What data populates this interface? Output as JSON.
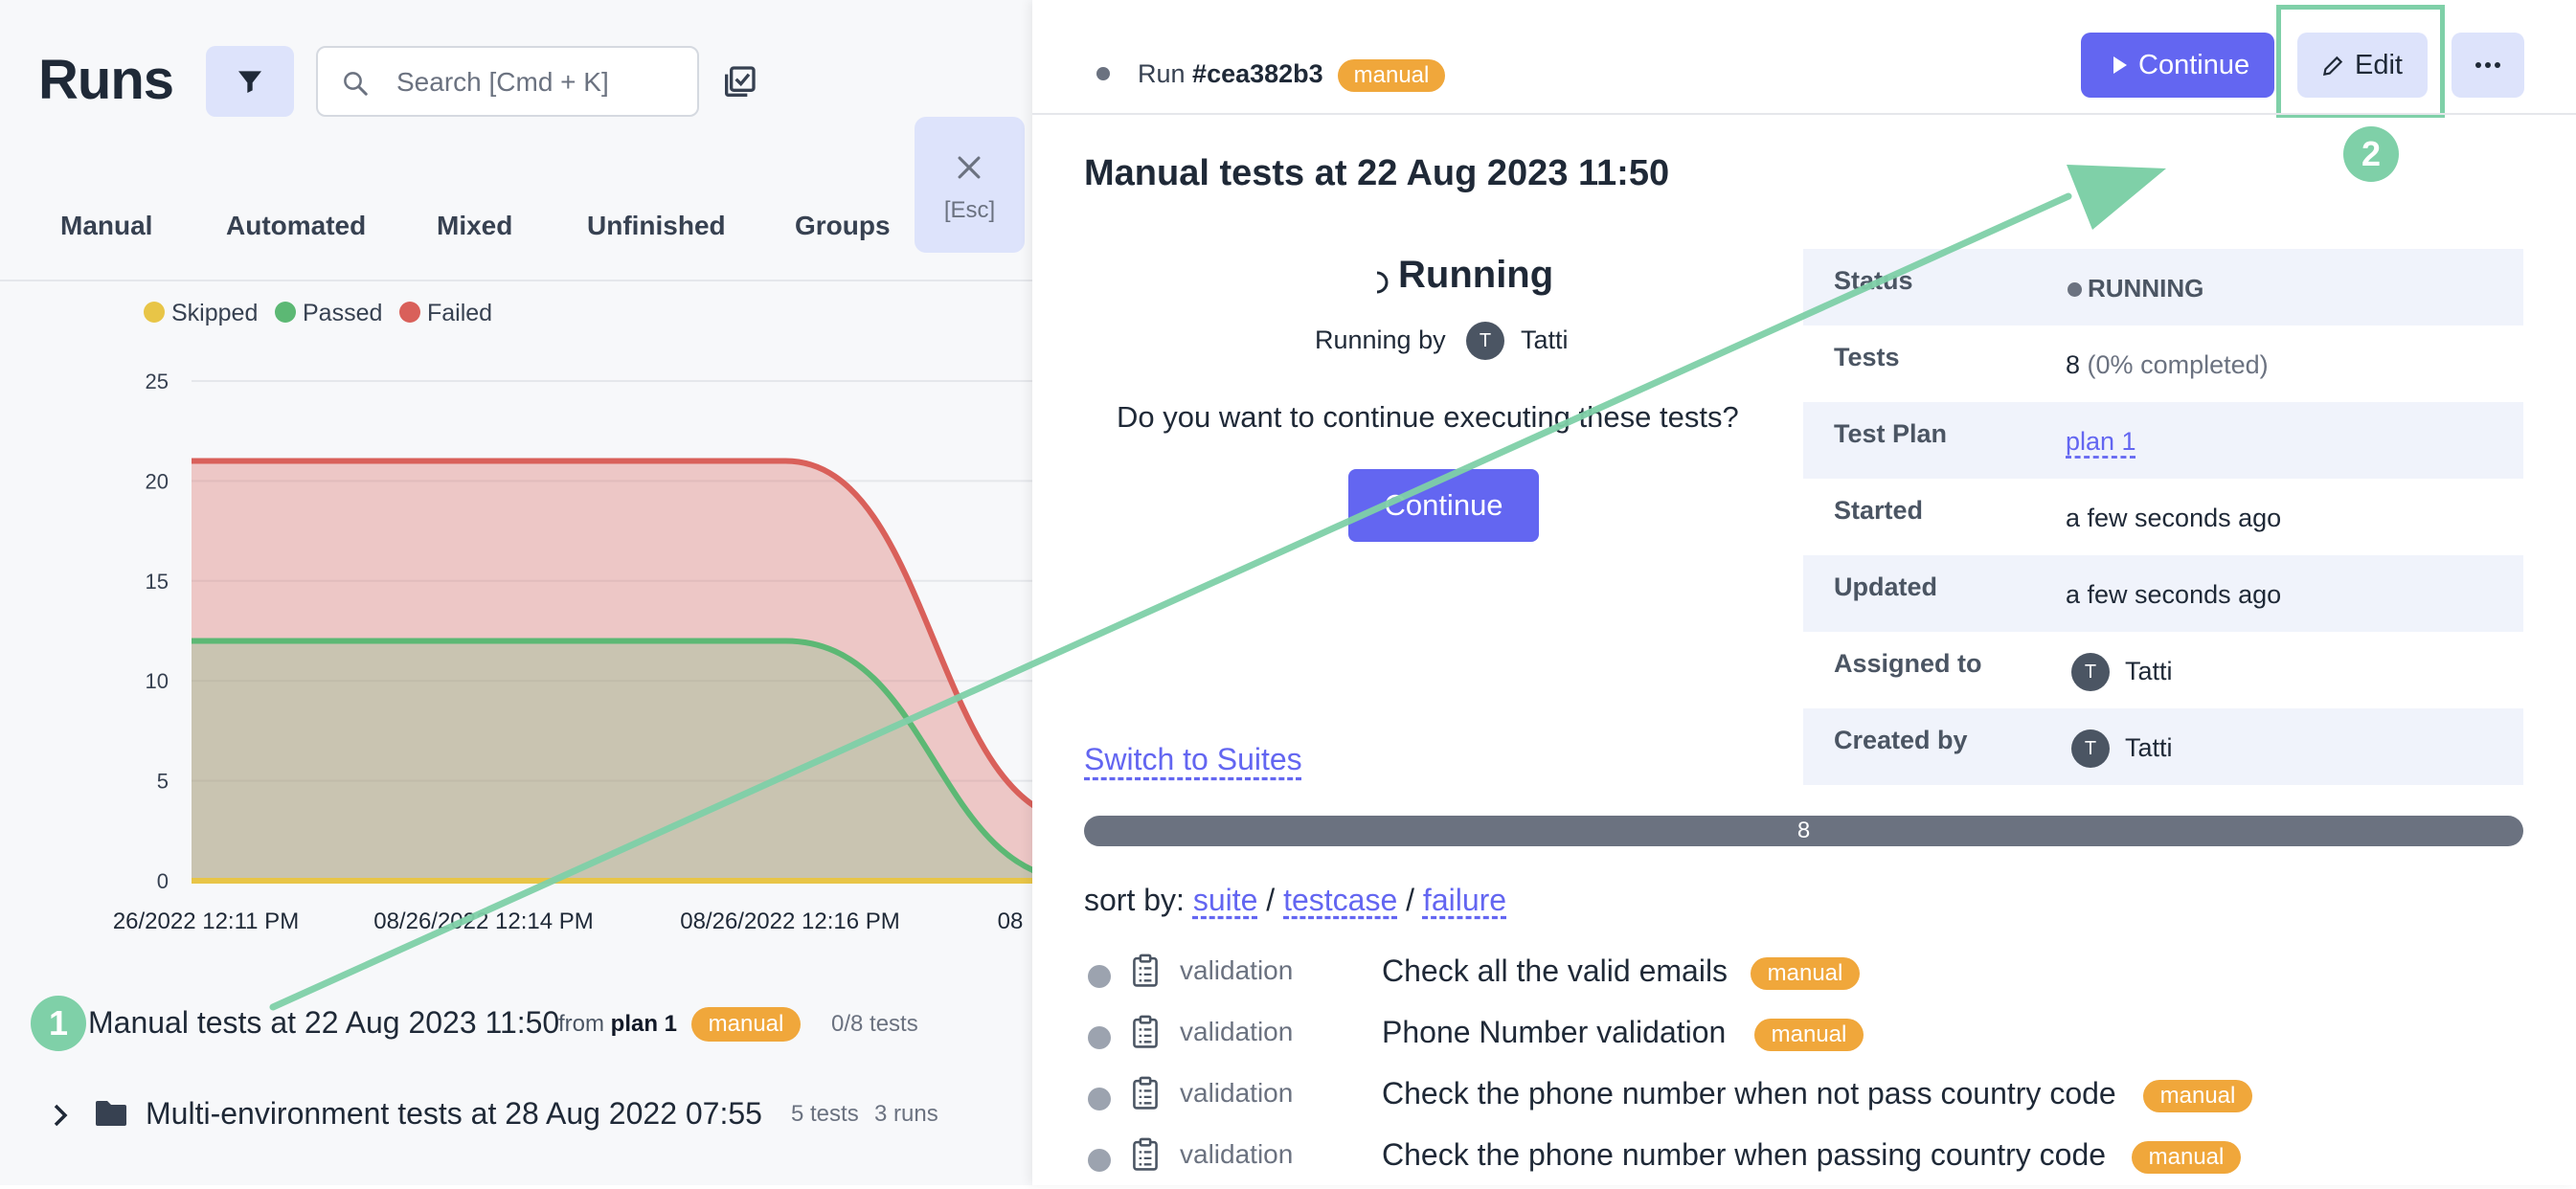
{
  "left": {
    "title": "Runs",
    "search": {
      "placeholder": "Search [Cmd + K]"
    },
    "tabs": [
      "Manual",
      "Automated",
      "Mixed",
      "Unfinished",
      "Groups"
    ],
    "close": {
      "esc_label": "[Esc]"
    },
    "runs": [
      {
        "marker": "1",
        "title": "Manual tests at 22 Aug 2023 11:50",
        "from_label": "from",
        "plan": "plan 1",
        "badge": "manual",
        "tests": "0/8 tests"
      },
      {
        "title": "Multi-environment tests at 28 Aug 2022 07:55",
        "tests": "5 tests",
        "runs": "3 runs"
      }
    ]
  },
  "chart_data": {
    "type": "area",
    "legend": [
      {
        "name": "Skipped",
        "color": "#e8c547"
      },
      {
        "name": "Passed",
        "color": "#5cb874"
      },
      {
        "name": "Failed",
        "color": "#d9605a"
      }
    ],
    "legend_position": "top-left",
    "x_tick_labels": [
      "26/2022 12:11 PM",
      "08/26/2022 12:14 PM",
      "08/26/2022 12:16 PM",
      "08"
    ],
    "yticks": [
      0,
      5,
      10,
      15,
      20,
      25
    ],
    "ylim": [
      0,
      25
    ],
    "grid": true,
    "series": [
      {
        "name": "Failed",
        "values": [
          21,
          21,
          21,
          3
        ]
      },
      {
        "name": "Passed",
        "values": [
          12,
          12,
          12,
          0
        ]
      },
      {
        "name": "Skipped",
        "values": [
          0,
          0,
          0,
          0
        ]
      }
    ]
  },
  "header": {
    "run_label": "Run",
    "run_id": "#cea382b3",
    "badge": "manual",
    "continue_label": "Continue",
    "edit_label": "Edit",
    "marker": "2"
  },
  "detail": {
    "title": "Manual tests at 22 Aug 2023 11:50",
    "status_heading": "Running",
    "running_by_label": "Running by",
    "running_by_user": "Tatti",
    "avatar_initial": "T",
    "question": "Do you want to continue executing these tests?",
    "continue_label": "Continue",
    "switch_label": "Switch to Suites",
    "progress_count": "8",
    "sort_label": "sort by:",
    "sort_options": [
      "suite",
      "testcase",
      "failure"
    ],
    "rows": [
      {
        "label": "Status",
        "value": "RUNNING"
      },
      {
        "label": "Tests",
        "value": "8",
        "extra": "(0% completed)"
      },
      {
        "label": "Test Plan",
        "value": "plan 1"
      },
      {
        "label": "Started",
        "value": "a few seconds ago"
      },
      {
        "label": "Updated",
        "value": "a few seconds ago"
      },
      {
        "label": "Assigned to",
        "value": "Tatti"
      },
      {
        "label": "Created by",
        "value": "Tatti"
      }
    ],
    "tests": [
      {
        "suite": "validation",
        "title": "Check all the valid emails",
        "badge": "manual"
      },
      {
        "suite": "validation",
        "title": "Phone Number validation",
        "badge": "manual"
      },
      {
        "suite": "validation",
        "title": "Check the phone number when not pass country code",
        "badge": "manual"
      },
      {
        "suite": "validation",
        "title": "Check the phone number when passing country code",
        "badge": "manual"
      }
    ]
  }
}
